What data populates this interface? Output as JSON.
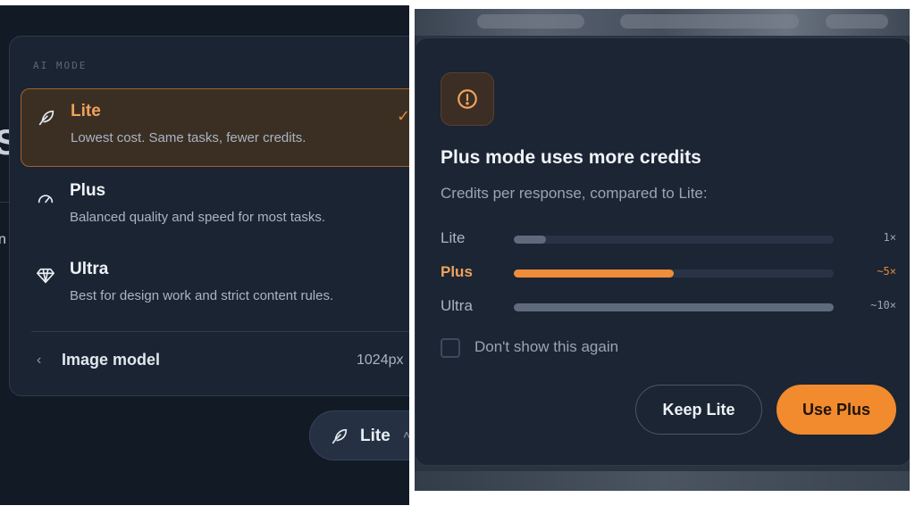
{
  "colors": {
    "accent": "#f28a2e",
    "accent_text": "#f0a25c",
    "panel_bg": "#1a2432",
    "page_bg": "#121a26"
  },
  "mode_menu": {
    "header": "AI MODE",
    "items": [
      {
        "name": "Lite",
        "description": "Lowest cost. Same tasks, fewer credits.",
        "icon": "feather-icon",
        "selected": true
      },
      {
        "name": "Plus",
        "description": "Balanced quality and speed for most tasks.",
        "icon": "gauge-icon",
        "selected": false
      },
      {
        "name": "Ultra",
        "description": "Best for design work and strict content rules.",
        "icon": "diamond-icon",
        "selected": false
      }
    ],
    "image_model": {
      "label": "Image model",
      "value": "1024px"
    },
    "check_mark": "✓"
  },
  "mode_pill": {
    "label": "Lite",
    "icon": "feather-icon"
  },
  "dialog": {
    "icon": "alert-circle-icon",
    "title": "Plus mode uses more credits",
    "subtitle": "Credits per response, compared to Lite:",
    "rows": [
      {
        "name": "Lite",
        "multiplier": "1×",
        "level": 0.1
      },
      {
        "name": "Plus",
        "multiplier": "~5×",
        "level": 0.5
      },
      {
        "name": "Ultra",
        "multiplier": "~10×",
        "level": 1.0
      }
    ],
    "active_row": "Plus",
    "dont_show_label": "Don't show this again",
    "keep_button": "Keep Lite",
    "use_button": "Use Plus"
  }
}
